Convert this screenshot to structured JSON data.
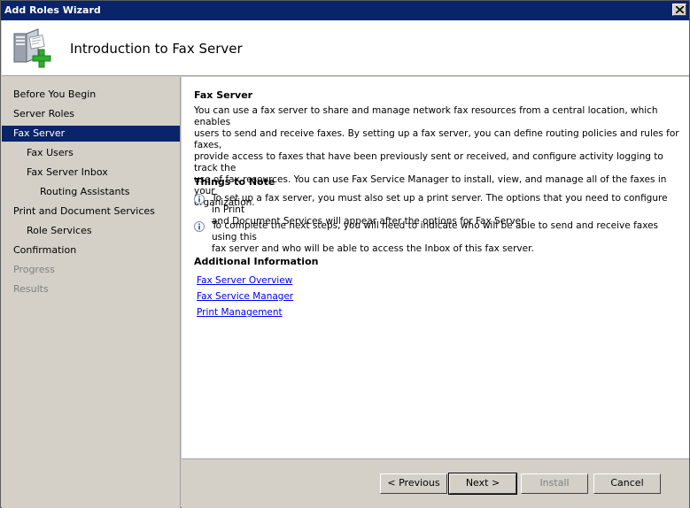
{
  "window": {
    "title": "Add Roles Wizard"
  },
  "header": {
    "title": "Introduction to Fax Server",
    "icon": "server-role-add-icon"
  },
  "nav": {
    "items": [
      {
        "label": "Before You Begin",
        "state": "normal"
      },
      {
        "label": "Server Roles",
        "state": "normal"
      },
      {
        "label": "Fax Server",
        "state": "active"
      },
      {
        "label": "Fax Users",
        "state": "normal"
      },
      {
        "label": "Fax Server Inbox",
        "state": "normal"
      },
      {
        "label": "Routing Assistants",
        "state": "normal"
      },
      {
        "label": "Print and Document Services",
        "state": "normal"
      },
      {
        "label": "Role Services",
        "state": "normal"
      },
      {
        "label": "Confirmation",
        "state": "normal"
      },
      {
        "label": "Progress",
        "state": "disabled"
      },
      {
        "label": "Results",
        "state": "disabled"
      }
    ]
  },
  "content": {
    "fax_title": "Fax Server",
    "fax_lines": [
      "You can use a fax server to share and manage network fax resources from a central location, which enables",
      "users to send and receive faxes. By setting up a fax server, you can define routing policies and rules for faxes,",
      "provide access to faxes that have been previously sent or received, and configure activity logging to track the",
      "use of fax resources. You can use Fax Service Manager to install, view, and manage all of the faxes in your",
      "organization."
    ],
    "notes_title": "Things to Note",
    "note1_lines": [
      "To set up a fax server, you must also set up a print server. The options that you need to configure in Print",
      "and Document Services will appear after the options for Fax Server."
    ],
    "note2_lines": [
      "To complete the next steps, you will need to indicate who will be able to send and receive faxes using this",
      "fax server and who will be able to access the Inbox of this fax server."
    ],
    "info_title": "Additional Information",
    "links": [
      "Fax Server Overview",
      "Fax Service Manager",
      "Print Management"
    ]
  },
  "buttons": {
    "previous": "< Previous",
    "next": "Next >",
    "install": "Install",
    "cancel": "Cancel"
  },
  "colors": {
    "titlebar": "#0a246a",
    "selection": "#0a246a",
    "link": "#0000ee"
  }
}
